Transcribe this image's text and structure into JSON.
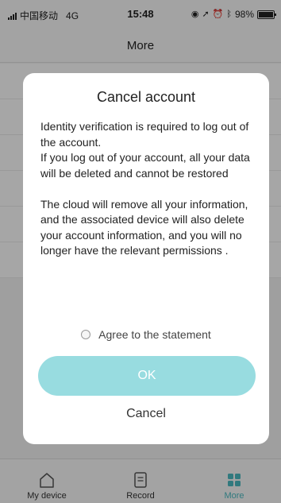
{
  "status_bar": {
    "carrier": "中国移动",
    "network": "4G",
    "time": "15:48",
    "battery": "98%",
    "battery_level": 0.98
  },
  "navbar": {
    "title": "More"
  },
  "dialog": {
    "title": "Cancel account",
    "paragraph1": "Identity verification is required to log out of the account.",
    "paragraph2": "If you log out of your account, all your data will be deleted and cannot be restored",
    "paragraph3": "The cloud will remove all your information, and the associated device will also delete your account information, and you will no longer have the relevant permissions .",
    "agree_label": "Agree to the statement",
    "ok_label": "OK",
    "cancel_label": "Cancel"
  },
  "tabbar": {
    "items": [
      {
        "label": "My device",
        "icon": "home-icon",
        "active": false
      },
      {
        "label": "Record",
        "icon": "record-icon",
        "active": false
      },
      {
        "label": "More",
        "icon": "grid-icon",
        "active": true
      }
    ]
  },
  "colors": {
    "accent": "#4cbbc2",
    "ok_button": "#98dce0"
  }
}
